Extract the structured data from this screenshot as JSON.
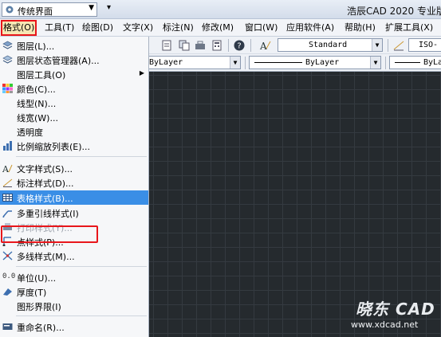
{
  "titlebar": {
    "workspace": "传统界面",
    "app_title": "浩辰CAD 2020 专业版"
  },
  "menubar": {
    "items": [
      "格式(O)",
      "工具(T)",
      "绘图(D)",
      "文字(X)",
      "标注(N)",
      "修改(M)",
      "窗口(W)",
      "应用软件(A)",
      "帮助(H)",
      "扩展工具(X)"
    ]
  },
  "toolbar": {
    "text_style": "Standard",
    "dim_style": "ISO-",
    "layer_combo": "ByLayer",
    "linetype_combo": "ByLayer",
    "lineweight_combo": "ByLa"
  },
  "format_menu": {
    "items": [
      {
        "label": "图层(L)...",
        "icon": "layer-icon"
      },
      {
        "label": "图层状态管理器(A)...",
        "icon": "layer-state-icon"
      },
      {
        "label": "图层工具(O)",
        "icon": "",
        "submenu": true
      },
      {
        "label": "颜色(C)...",
        "icon": "color-palette-icon"
      },
      {
        "label": "线型(N)...",
        "icon": ""
      },
      {
        "label": "线宽(W)...",
        "icon": ""
      },
      {
        "label": "透明度",
        "icon": ""
      },
      {
        "label": "比例缩放列表(E)...",
        "icon": "scale-list-icon"
      },
      {
        "label": "文字样式(S)...",
        "icon": "text-style-icon"
      },
      {
        "label": "标注样式(D)...",
        "icon": "dim-style-icon"
      },
      {
        "label": "表格样式(B)...",
        "icon": "table-style-icon",
        "selected": true
      },
      {
        "label": "多重引线样式(I)",
        "icon": "mleader-style-icon"
      },
      {
        "label": "打印样式(Y)...",
        "icon": "plot-style-icon",
        "disabled": true
      },
      {
        "label": "点样式(P)...",
        "icon": "point-style-icon"
      },
      {
        "label": "多线样式(M)...",
        "icon": "mline-style-icon"
      },
      {
        "label": "单位(U)...",
        "icon": "units-icon"
      },
      {
        "label": "厚度(T)",
        "icon": "thickness-icon"
      },
      {
        "label": "图形界限(I)",
        "icon": ""
      },
      {
        "label": "重命名(R)...",
        "icon": "rename-icon"
      }
    ]
  },
  "watermark": {
    "brand": "晓东 CAD",
    "url": "www.xdcad.net"
  },
  "colors": {
    "highlight": "#3a8ee6",
    "annotation_red": "#e8161b",
    "canvas": "#252a2e"
  }
}
